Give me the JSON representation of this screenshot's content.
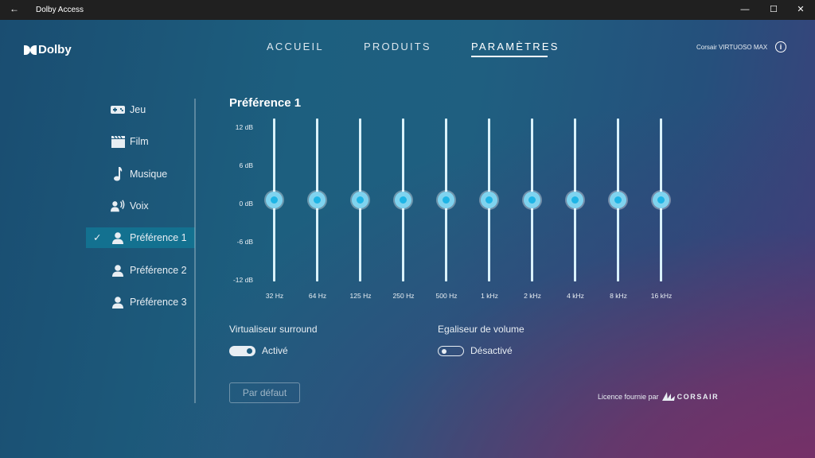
{
  "window": {
    "title": "Dolby Access",
    "back_glyph": "←",
    "minimize_glyph": "—",
    "maximize_glyph": "☐",
    "close_glyph": "✕"
  },
  "brand": {
    "name": "Dolby"
  },
  "nav": {
    "items": [
      "ACCUEIL",
      "PRODUITS",
      "PARAMÈTRES"
    ],
    "active_index": 2
  },
  "device": {
    "name": "Corsair VIRTUOSO MAX",
    "info_glyph": "i"
  },
  "sidebar": {
    "items": [
      {
        "label": "Jeu",
        "icon": "gamepad-icon"
      },
      {
        "label": "Film",
        "icon": "clapperboard-icon"
      },
      {
        "label": "Musique",
        "icon": "music-note-icon"
      },
      {
        "label": "Voix",
        "icon": "voice-icon"
      },
      {
        "label": "Préférence 1",
        "icon": "person-icon"
      },
      {
        "label": "Préférence 2",
        "icon": "person-icon"
      },
      {
        "label": "Préférence 3",
        "icon": "person-icon"
      }
    ],
    "active_index": 4,
    "check_glyph": "✓"
  },
  "equalizer": {
    "title": "Préférence 1",
    "db_labels": [
      "12 dB",
      "6 dB",
      "0 dB",
      "-6 dB",
      "-12 dB"
    ],
    "bands": [
      {
        "freq": "32 Hz",
        "gain_db": 0
      },
      {
        "freq": "64 Hz",
        "gain_db": 0
      },
      {
        "freq": "125 Hz",
        "gain_db": 0
      },
      {
        "freq": "250 Hz",
        "gain_db": 0
      },
      {
        "freq": "500 Hz",
        "gain_db": 0
      },
      {
        "freq": "1 kHz",
        "gain_db": 0
      },
      {
        "freq": "2 kHz",
        "gain_db": 0
      },
      {
        "freq": "4 kHz",
        "gain_db": 0
      },
      {
        "freq": "8 kHz",
        "gain_db": 0
      },
      {
        "freq": "16 kHz",
        "gain_db": 0
      }
    ]
  },
  "options": {
    "surround": {
      "title": "Virtualiseur surround",
      "state": "Activé",
      "on": true
    },
    "volume": {
      "title": "Egaliseur de volume",
      "state": "Désactivé",
      "on": false
    }
  },
  "actions": {
    "default_label": "Par défaut"
  },
  "footer": {
    "licence_text": "Licence fournie par",
    "licence_brand": "CORSAIR"
  },
  "colors": {
    "accent": "#137190",
    "thumb": "#1fb5e6",
    "track": "#d9f1fa"
  }
}
